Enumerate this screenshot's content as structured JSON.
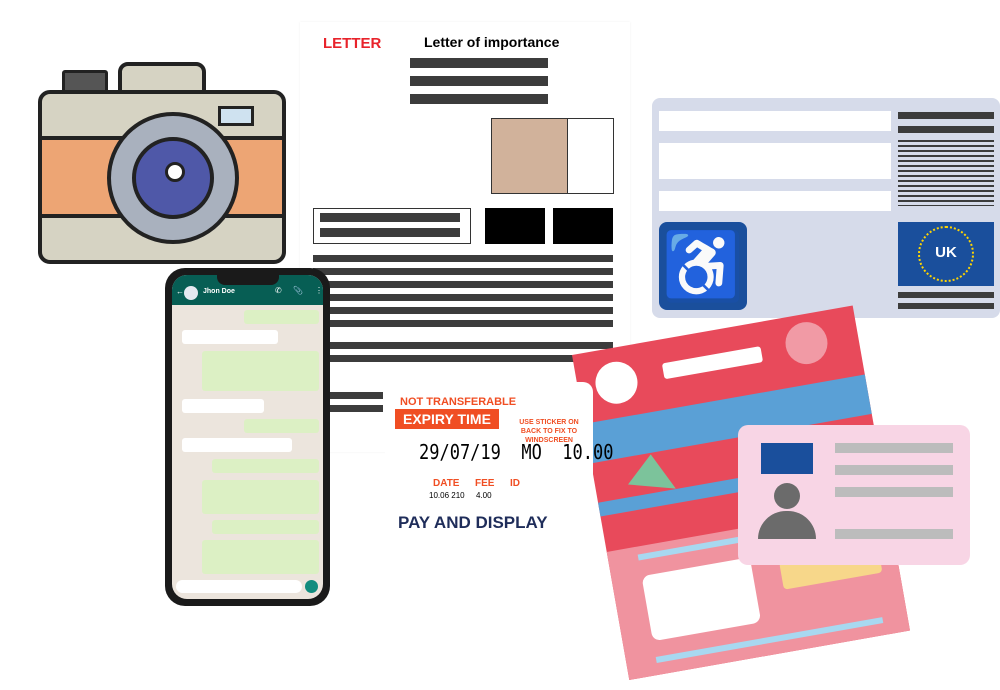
{
  "letter": {
    "label": "LETTER",
    "title": "Letter of importance"
  },
  "phone": {
    "contact_name": "Jhon Doe"
  },
  "badge": {
    "country": "UK"
  },
  "ticket": {
    "not_transferable": "NOT TRANSFERABLE",
    "expiry_label": "EXPIRY TIME",
    "sticker_note": "USE STICKER ON BACK TO FIX TO WINDSCREEN",
    "expiry_value": "29/07/19  MO  10.00",
    "date_label": "DATE",
    "fee_label": "FEE",
    "id_label": "ID",
    "date_value": "10.06 210",
    "fee_value": "4.00",
    "footer": "PAY AND DISPLAY"
  },
  "colors": {
    "orange": "#f04e23",
    "navy": "#1f2d5a",
    "badge_blue": "#1a4f9c",
    "card_bg": "#d6dbea",
    "ticket_red": "#e84a5b",
    "id_pink": "#f8d5e5"
  }
}
